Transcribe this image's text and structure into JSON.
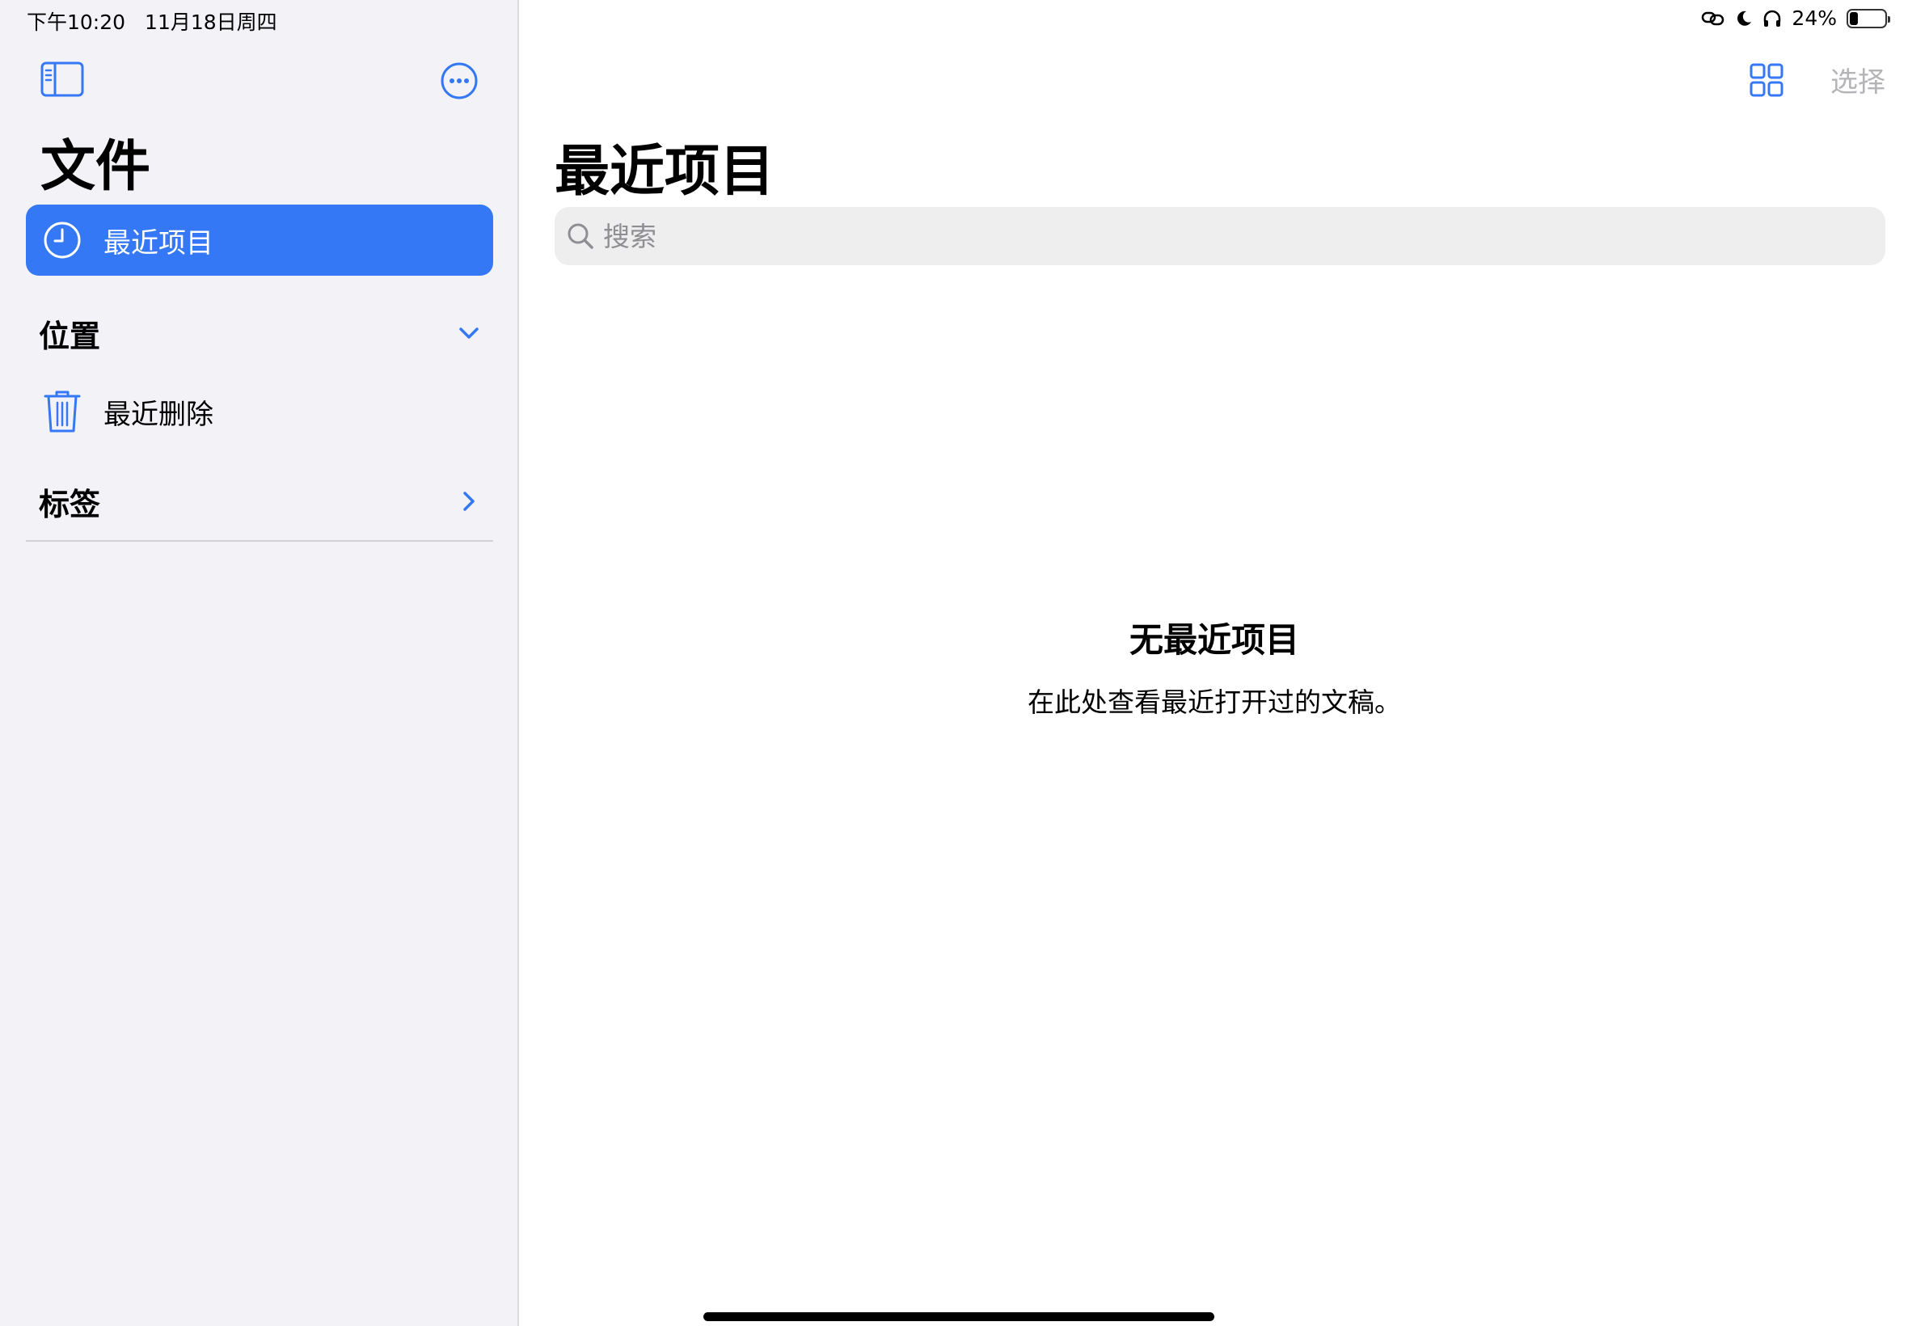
{
  "status_bar": {
    "time": "下午10:20",
    "date": "11月18日周四",
    "battery_text": "24%",
    "battery_level": 0.24
  },
  "sidebar": {
    "title": "文件",
    "recents_label": "最近项目",
    "locations_header": "位置",
    "trash_label": "最近删除",
    "tags_header": "标签"
  },
  "main": {
    "title": "最近项目",
    "select_label": "选择",
    "search": {
      "placeholder": "搜索",
      "value": ""
    },
    "empty_title": "无最近项目",
    "empty_subtitle": "在此处查看最近打开过的文稿。"
  },
  "colors": {
    "accent": "#3478f6",
    "sidebar_bg": "#f2f2f7",
    "disabled_text": "#b3b3b8"
  },
  "icons": {
    "sidebar_toggle": "sidebar-toggle-icon",
    "more": "ellipsis-circle-icon",
    "recents": "clock-icon",
    "trash": "trash-icon",
    "chevron_down": "chevron-down-icon",
    "chevron_right": "chevron-right-icon",
    "grid": "grid-view-icon",
    "search": "magnifier-icon"
  }
}
